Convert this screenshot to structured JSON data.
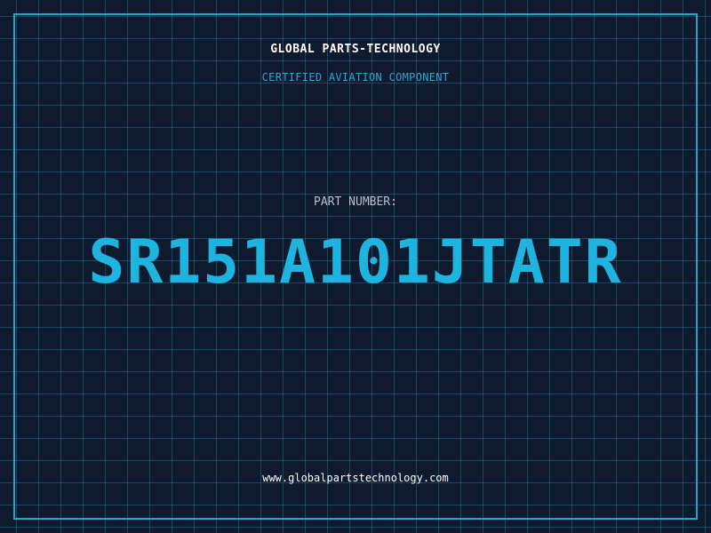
{
  "header": {
    "brand": "GLOBAL PARTS-TECHNOLOGY",
    "tagline": "CERTIFIED AVIATION COMPONENT"
  },
  "part": {
    "label": "PART NUMBER:",
    "number": "SR151A101JTATR"
  },
  "footer": {
    "website": "www.globalpartstechnology.com"
  },
  "colors": {
    "background": "#101a2e",
    "grid": "#1a6e8a",
    "frame": "#2aa3c8",
    "accent": "#1fb3e0",
    "label": "#b7c0cc",
    "text": "#ffffff"
  }
}
